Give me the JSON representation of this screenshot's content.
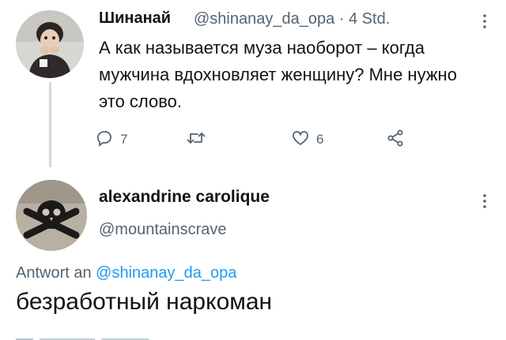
{
  "tweet1": {
    "author_name": "Шинанай",
    "handle_and_time": "@shinanay_da_opa · 4 Std.",
    "text": "А как называется муза наоборот – когда мужчина вдохновляет женщину? Мне нужно это слово.",
    "more_icon": "more-dots-icon",
    "actions": {
      "reply": {
        "icon": "reply-icon",
        "count": "7"
      },
      "retweet": {
        "icon": "retweet-icon",
        "count": ""
      },
      "like": {
        "icon": "heart-icon",
        "count": "6"
      },
      "share": {
        "icon": "share-icon",
        "count": ""
      }
    }
  },
  "tweet2": {
    "author_name": "alexandrine carolique",
    "handle": "@mountainscrave",
    "replying_prefix": "Antwort an",
    "replying_mention": "@shinanay_da_opa",
    "text": "безработный наркоман",
    "more_icon": "more-dots-icon"
  },
  "colors": {
    "text_primary": "#0f1419",
    "text_secondary": "#536471",
    "link": "#1d9bf0",
    "thread_line": "#cfd9de"
  }
}
